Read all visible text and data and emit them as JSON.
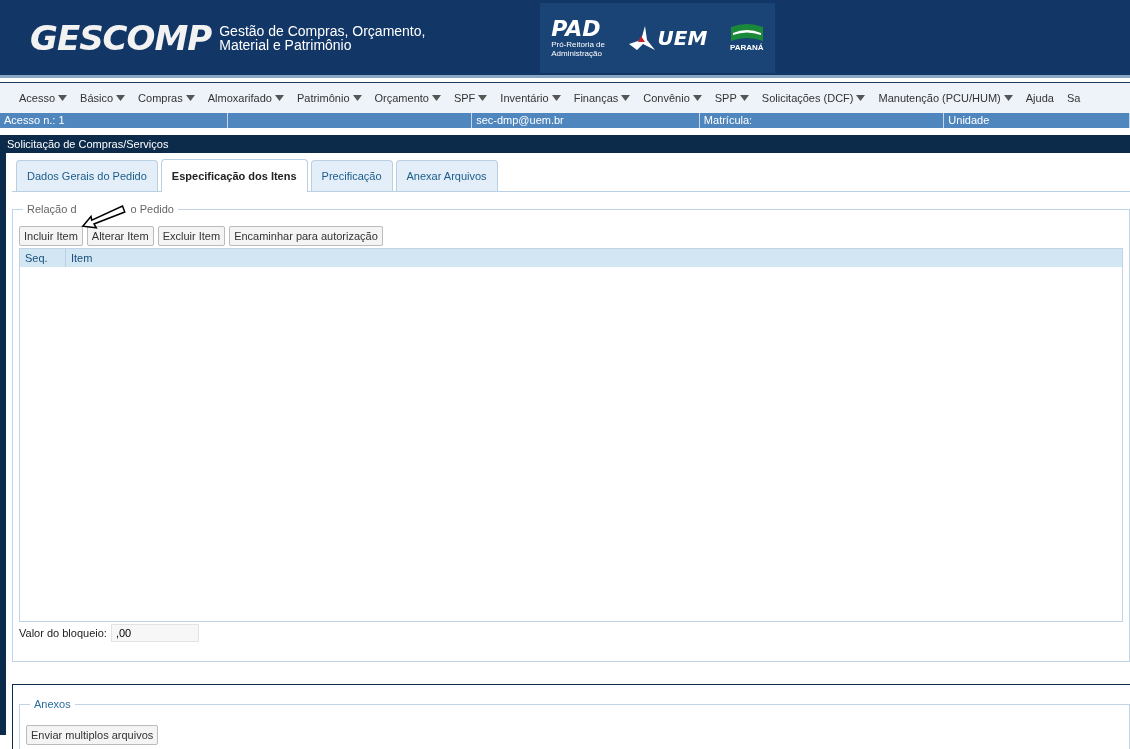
{
  "header": {
    "logo": "GESCOMP",
    "subtitle_lines": [
      "Gestão de Compras, Orçamento,",
      "Material e Patrimônio"
    ],
    "pad_logo": "PAD",
    "pad_caption_lines": [
      "Pró-Reitoria de",
      "Administração"
    ],
    "uem_logo": "UEM",
    "parana_logo": "PARANÁ"
  },
  "menu": [
    {
      "label": "Acesso",
      "dropdown": true
    },
    {
      "label": "Básico",
      "dropdown": true
    },
    {
      "label": "Compras",
      "dropdown": true
    },
    {
      "label": "Almoxarifado",
      "dropdown": true
    },
    {
      "label": "Patrimônio",
      "dropdown": true
    },
    {
      "label": "Orçamento",
      "dropdown": true
    },
    {
      "label": "SPF",
      "dropdown": true
    },
    {
      "label": "Inventário",
      "dropdown": true
    },
    {
      "label": "Finanças",
      "dropdown": true
    },
    {
      "label": "Convênio",
      "dropdown": true
    },
    {
      "label": "SPP",
      "dropdown": true
    },
    {
      "label": "Solicitações (DCF)",
      "dropdown": true
    },
    {
      "label": "Manutenção (PCU/HUM)",
      "dropdown": true
    },
    {
      "label": "Ajuda",
      "dropdown": false
    },
    {
      "label": "Sa",
      "dropdown": false
    }
  ],
  "status_bar": [
    {
      "kind": "text",
      "text": "Acesso n.: 1"
    },
    {
      "kind": "blank"
    },
    {
      "kind": "text",
      "text": "sec-dmp@uem.br"
    },
    {
      "kind": "text",
      "text": "Matrícula:"
    },
    {
      "kind": "text",
      "text": "Unidade"
    }
  ],
  "panel_title": "Solicitação de Compras/Serviços",
  "tabs": [
    {
      "label": "Dados Gerais do Pedido",
      "selected": false
    },
    {
      "label": "Especificação dos Itens",
      "selected": true
    },
    {
      "label": "Precificação",
      "selected": false
    },
    {
      "label": "Anexar Arquivos",
      "selected": false
    }
  ],
  "items_section": {
    "legend_parts": [
      "Relação d",
      "o Pedido"
    ],
    "buttons": [
      "Incluir Item",
      "Alterar Item",
      "Excluir Item",
      "Encaminhar para autorização"
    ],
    "columns": [
      "Seq.",
      "Item"
    ],
    "block_label": "Valor do bloqueio:",
    "block_value": ",00"
  },
  "attachments": {
    "legend": "Anexos",
    "button": "Enviar multiplos arquivos"
  }
}
